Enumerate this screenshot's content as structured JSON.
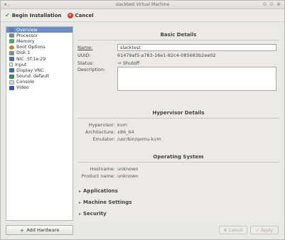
{
  "window": {
    "title": "slacktest Virtual Machine"
  },
  "toolbar": {
    "begin_label": "Begin Installation",
    "cancel_label": "Cancel"
  },
  "sidebar": {
    "items": [
      {
        "label": "Overview",
        "icon": "overview-icon"
      },
      {
        "label": "Processor",
        "icon": "processor-icon"
      },
      {
        "label": "Memory",
        "icon": "memory-icon"
      },
      {
        "label": "Boot Options",
        "icon": "boot-options-icon"
      },
      {
        "label": "Disk 1",
        "icon": "disk-icon"
      },
      {
        "label": "NIC :5f:1e:29",
        "icon": "nic-icon"
      },
      {
        "label": "Input",
        "icon": "input-icon"
      },
      {
        "label": "Display VNC",
        "icon": "display-icon"
      },
      {
        "label": "Sound: default",
        "icon": "sound-icon"
      },
      {
        "label": "Console",
        "icon": "console-icon"
      },
      {
        "label": "Video",
        "icon": "video-icon"
      }
    ],
    "selected_index": 0,
    "add_hardware_label": "Add Hardware"
  },
  "basic": {
    "heading": "Basic Details",
    "name_label": "Name:",
    "name_value": "slacktest",
    "uuid_label": "UUID:",
    "uuid_value": "61479af5-a783-16e1-82c4-085683b2ee02",
    "status_label": "Status:",
    "status_value": "Shutoff",
    "description_label": "Description:"
  },
  "hypervisor": {
    "heading": "Hypervisor Details",
    "hypervisor_label": "Hypervisor:",
    "hypervisor_value": "kvm",
    "arch_label": "Architecture:",
    "arch_value": "x86_64",
    "emulator_label": "Emulator:",
    "emulator_value": "/usr/bin/qemu-kvm"
  },
  "os": {
    "heading": "Operating System",
    "hostname_label": "Hostname:",
    "hostname_value": "unknown",
    "product_label": "Product name:",
    "product_value": "unknown"
  },
  "expanders": {
    "applications": "Applications",
    "machine_settings": "Machine Settings",
    "security": "Security"
  },
  "footer": {
    "cancel_label": "Cancel",
    "apply_label": "Apply"
  }
}
